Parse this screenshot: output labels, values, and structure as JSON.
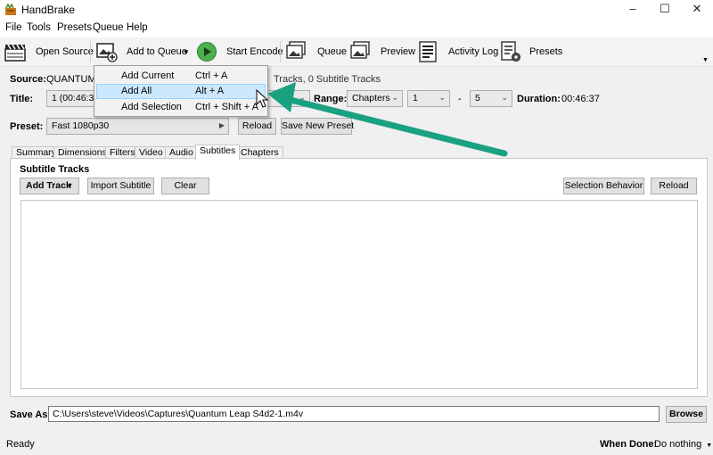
{
  "window": {
    "title": "HandBrake"
  },
  "menu": [
    "File",
    "Tools",
    "Presets",
    "Queue",
    "Help"
  ],
  "toolbar": {
    "open_source": "Open Source",
    "add_to_queue": "Add to Queue",
    "start_encode": "Start Encode",
    "queue": "Queue",
    "preview": "Preview",
    "activity_log": "Activity Log",
    "presets": "Presets"
  },
  "add_queue_menu": {
    "items": [
      {
        "label": "Add Current",
        "shortcut": "Ctrl + A"
      },
      {
        "label": "Add All",
        "shortcut": "Alt + A"
      },
      {
        "label": "Add Selection",
        "shortcut": "Ctrl + Shift + A"
      }
    ]
  },
  "source": {
    "label": "Source:",
    "value": "QUANTUM_L",
    "tracks_info": "Tracks, 0 Subtitle Tracks"
  },
  "title_row": {
    "title_label": "Title:",
    "title_value": "1 (00:46:36)",
    "range_label": "Range:",
    "range_value": "Chapters",
    "range_start": "1",
    "range_dash": "-",
    "range_end": "5",
    "duration_label": "Duration:",
    "duration_value": "00:46:37"
  },
  "preset": {
    "label": "Preset:",
    "value": "Fast 1080p30",
    "reload": "Reload",
    "save_new": "Save New Preset"
  },
  "tabs": [
    {
      "label": "Summary",
      "active": false
    },
    {
      "label": "Dimensions",
      "active": false
    },
    {
      "label": "Filters",
      "active": false
    },
    {
      "label": "Video",
      "active": false
    },
    {
      "label": "Audio",
      "active": false
    },
    {
      "label": "Subtitles",
      "active": true
    },
    {
      "label": "Chapters",
      "active": false
    }
  ],
  "subtitles": {
    "heading": "Subtitle Tracks",
    "add_track": "Add Track",
    "import": "Import Subtitle",
    "clear": "Clear",
    "selection_behavior": "Selection Behavior",
    "reload": "Reload"
  },
  "save_as": {
    "label": "Save As:",
    "path": "C:\\Users\\steve\\Videos\\Captures\\Quantum Leap S4d2-1.m4v",
    "browse": "Browse"
  },
  "status": {
    "text": "Ready",
    "when_done_label": "When Done:",
    "when_done_value": "Do nothing"
  },
  "colors": {
    "menu_hover": "#cce8ff",
    "arrow": "#1aa181",
    "play_green": "#4caf50"
  }
}
